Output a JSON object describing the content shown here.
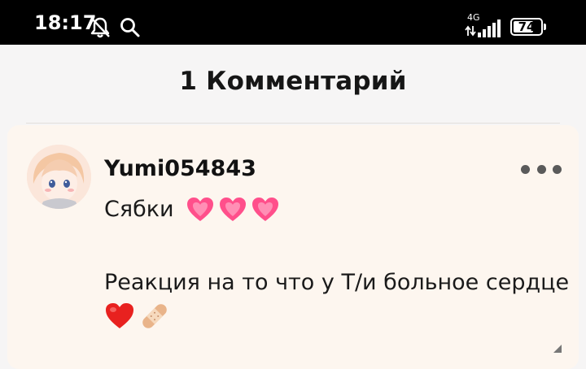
{
  "status_bar": {
    "time": "18:17",
    "network_type": "4G",
    "battery_level": "74",
    "battery_fraction": 0.74,
    "icons": [
      "bell-off-icon",
      "search-icon",
      "signal-icon",
      "battery-icon"
    ]
  },
  "header": {
    "title": "1 Комментарий"
  },
  "comment": {
    "username": "Yumi054843",
    "line1_text": "Сябки",
    "line1_emoji": [
      "pink-heart",
      "pink-heart",
      "pink-heart"
    ],
    "line2_text": "Реакция на то что у Т/и больное сердце",
    "line3_emoji": [
      "red-heart",
      "bandage"
    ]
  },
  "colors": {
    "status_bar_bg": "#000000",
    "header_bg": "#f6f5f5",
    "card_bg": "#fdf6ef",
    "pink_heart": "#ff4f8b",
    "red_heart": "#e8211f"
  }
}
